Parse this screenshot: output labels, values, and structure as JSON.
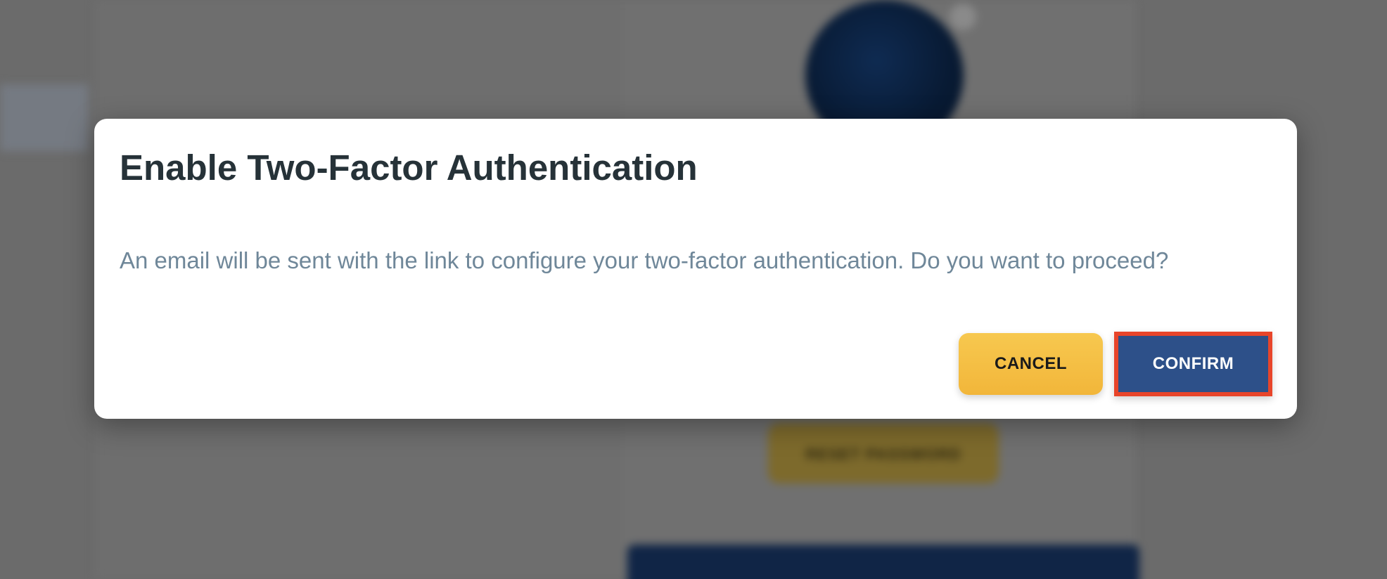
{
  "background": {
    "reset_button_label": "RESET PASSWORD"
  },
  "dialog": {
    "title": "Enable Two-Factor Authentication",
    "message": "An email will be sent with the link to configure your two-factor authentication. Do you want to proceed?",
    "cancel_label": "CANCEL",
    "confirm_label": "CONFIRM"
  },
  "colors": {
    "cancel_button": "#f4bd42",
    "confirm_button": "#2d5089",
    "confirm_highlight_border": "#e8452a",
    "title_text": "#263238",
    "message_text": "#6f8799",
    "overlay": "#6b6b6b"
  }
}
